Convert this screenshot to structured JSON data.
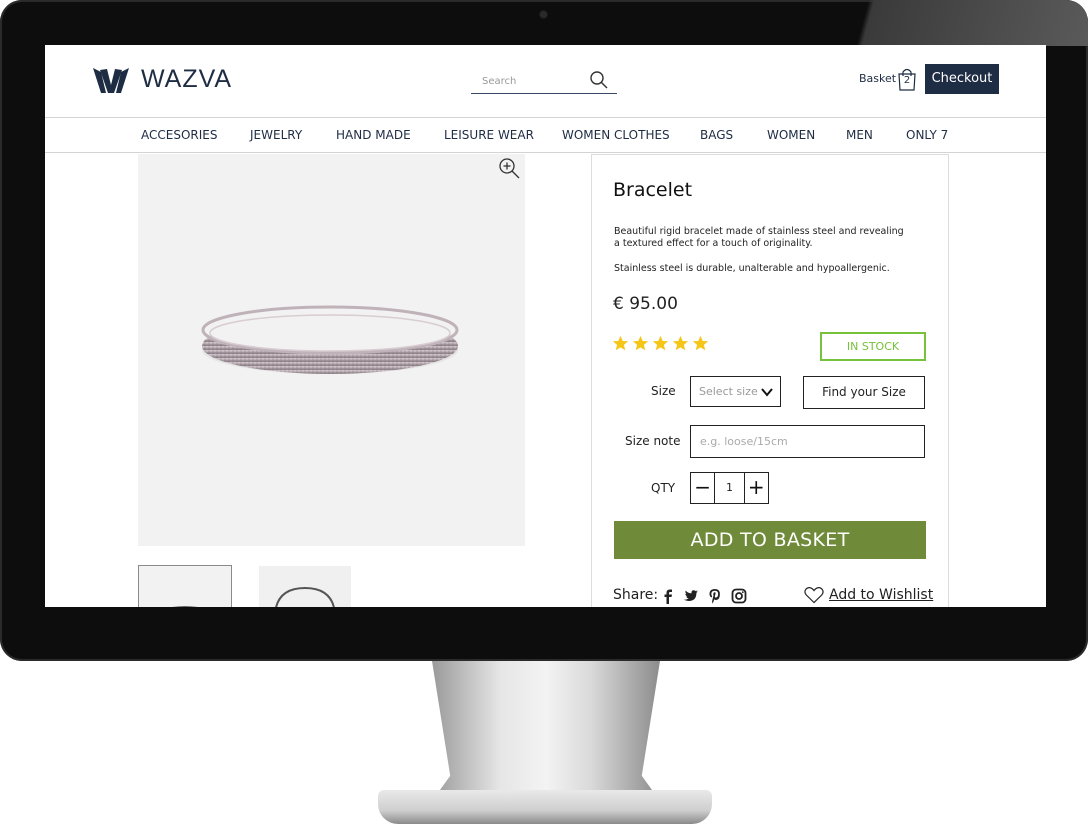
{
  "header": {
    "logo_text": "WAZVA",
    "search_placeholder": "Search",
    "basket_label": "Basket",
    "basket_count": "2",
    "checkout_label": "Checkout"
  },
  "nav": {
    "items": [
      "ACCESORIES",
      "JEWELRY",
      "HAND MADE",
      "LEISURE WEAR",
      "WOMEN CLOTHES",
      "BAGS",
      "WOMEN",
      "MEN",
      "ONLY 7"
    ]
  },
  "product": {
    "title": "Bracelet",
    "description": "Beautiful rigid bracelet made of stainless steel and revealing a textured effect for a touch of originality.",
    "description2": "Stainless steel is durable, unalterable and hypoallergenic.",
    "price": "€ 95.00",
    "rating": 5,
    "rating_max": 5,
    "stock_status": "IN STOCK",
    "size_label": "Size",
    "size_select_value": "Select size",
    "find_size_label": "Find your Size",
    "size_note_label": "Size note",
    "size_note_placeholder": "e.g. loose/15cm",
    "qty_label": "QTY",
    "qty_value": "1",
    "qty_minus": "−",
    "qty_plus": "+",
    "add_to_basket_label": "ADD TO BASKET",
    "share_label": "Share:",
    "wishlist_label": "Add to Wishlist"
  },
  "colors": {
    "brand_navy": "#1e2c44",
    "add_button_green": "#6f8a38",
    "in_stock_green": "#76c23a",
    "star_yellow": "#f5c518"
  },
  "icons": {
    "search": "search-icon",
    "basket": "shopping-bag-icon",
    "zoom": "zoom-in-icon",
    "facebook": "facebook-icon",
    "twitter": "twitter-icon",
    "pinterest": "pinterest-icon",
    "instagram": "instagram-icon",
    "wishlist": "heart-icon"
  }
}
